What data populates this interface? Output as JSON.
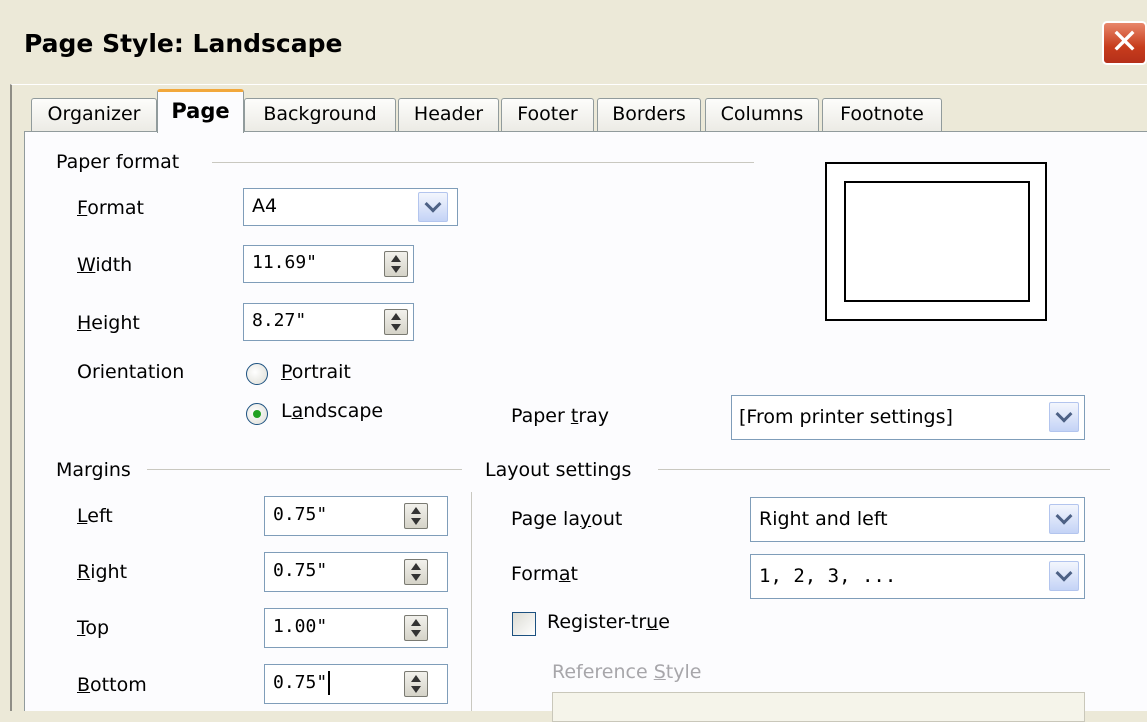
{
  "window": {
    "title": "Page Style: Landscape",
    "close_glyph": "✕"
  },
  "tabs": [
    {
      "label": "Organizer"
    },
    {
      "label": "Page",
      "active": true
    },
    {
      "label": "Background"
    },
    {
      "label": "Header"
    },
    {
      "label": "Footer"
    },
    {
      "label": "Borders"
    },
    {
      "label": "Columns"
    },
    {
      "label": "Footnote"
    }
  ],
  "paper_format": {
    "heading": "Paper format",
    "format": {
      "label_pre": "",
      "label_u": "F",
      "label_post": "ormat",
      "value": "A4"
    },
    "width": {
      "label_u": "W",
      "label_post": "idth",
      "value": "11.69\""
    },
    "height": {
      "label_u": "H",
      "label_post": "eight",
      "value": "8.27\""
    },
    "orientation": {
      "label": "Orientation",
      "portrait": {
        "label_u": "P",
        "label_post": "ortrait",
        "checked": false
      },
      "landscape": {
        "label_pre": "L",
        "label_u": "a",
        "label_post": "ndscape",
        "checked": true
      }
    },
    "paper_tray": {
      "label_pre": "Paper ",
      "label_u": "t",
      "label_post": "ray",
      "value": "[From printer settings]"
    }
  },
  "margins": {
    "heading": "Margins",
    "left": {
      "label_u": "L",
      "label_post": "eft",
      "value": "0.75\""
    },
    "right": {
      "label_u": "R",
      "label_post": "ight",
      "value": "0.75\""
    },
    "top": {
      "label_u": "T",
      "label_post": "op",
      "value": "1.00\""
    },
    "bottom": {
      "label_u": "B",
      "label_post": "ottom",
      "value": "0.75\""
    }
  },
  "layout_settings": {
    "heading": "Layout settings",
    "page_layout": {
      "label_pre": "Page la",
      "label_u": "y",
      "label_post": "out",
      "value": "Right and left"
    },
    "format": {
      "label_pre": "Form",
      "label_u": "a",
      "label_post": "t",
      "value": "1, 2, 3, ..."
    },
    "register_true": {
      "label_pre": "Register-tr",
      "label_u": "u",
      "label_post": "e",
      "checked": false
    },
    "reference_style": {
      "label_pre": "Reference ",
      "label_u": "S",
      "label_post": "tyle",
      "value": ""
    }
  },
  "colors": {
    "dialog_bg": "#ece9d8",
    "panel_bg": "#fcfcfe",
    "active_tab_accent": "#f2a83c",
    "close_red": "#c73c1c"
  }
}
